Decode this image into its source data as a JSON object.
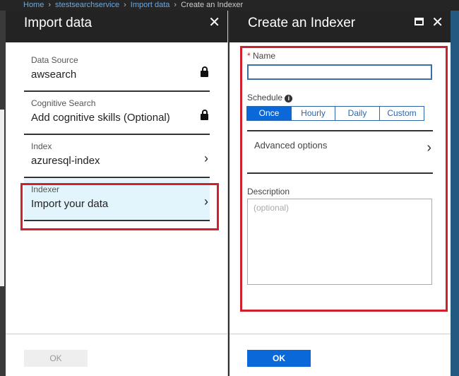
{
  "breadcrumb": [
    "Home",
    "stestsearchservice",
    "Import data",
    "Create an Indexer"
  ],
  "left": {
    "title": "Import data",
    "steps": [
      {
        "title": "Data Source",
        "value": "awsearch",
        "icon": "lock-icon"
      },
      {
        "title": "Cognitive Search",
        "value": "Add cognitive skills (Optional)",
        "icon": "lock-icon"
      },
      {
        "title": "Index",
        "value": "azuresql-index",
        "icon": "chevron-right-icon"
      },
      {
        "title": "Indexer",
        "value": "Import your data",
        "icon": "chevron-right-icon"
      }
    ],
    "ok": "OK",
    "chevron": "›"
  },
  "right": {
    "title": "Create an Indexer",
    "name_label": "Name",
    "required": "*",
    "name_value": "",
    "schedule_label": "Schedule",
    "schedule_options": [
      "Once",
      "Hourly",
      "Daily",
      "Custom"
    ],
    "schedule_selected": "Once",
    "advanced": "Advanced options",
    "description_label": "Description",
    "description_placeholder": "(optional)",
    "ok": "OK"
  },
  "colors": {
    "accent": "#0b68d8",
    "highlight": "#d0202e"
  }
}
